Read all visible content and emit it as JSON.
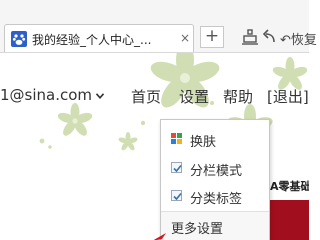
{
  "browser": {
    "tab_title": "我的经验_个人中心_...",
    "tab_close": "×",
    "new_tab": "+",
    "restore_label": "↶恢复"
  },
  "header": {
    "user_email": "1@sina.com",
    "nav": {
      "home": "首页",
      "settings": "设置",
      "help": "帮助",
      "logout": "[退出]"
    }
  },
  "settings_menu": {
    "items": [
      {
        "label": "换肤",
        "icon": "skin-icon"
      },
      {
        "label": "分栏模式",
        "checked": true
      },
      {
        "label": "分类标签",
        "checked": true
      },
      {
        "label": "更多设置"
      }
    ]
  },
  "content": {
    "snippet": "A零基础"
  },
  "colors": {
    "accent_red": "#a10f1e",
    "leaf_green": "#b9cc93",
    "favicon_blue": "#2e5fc8"
  }
}
